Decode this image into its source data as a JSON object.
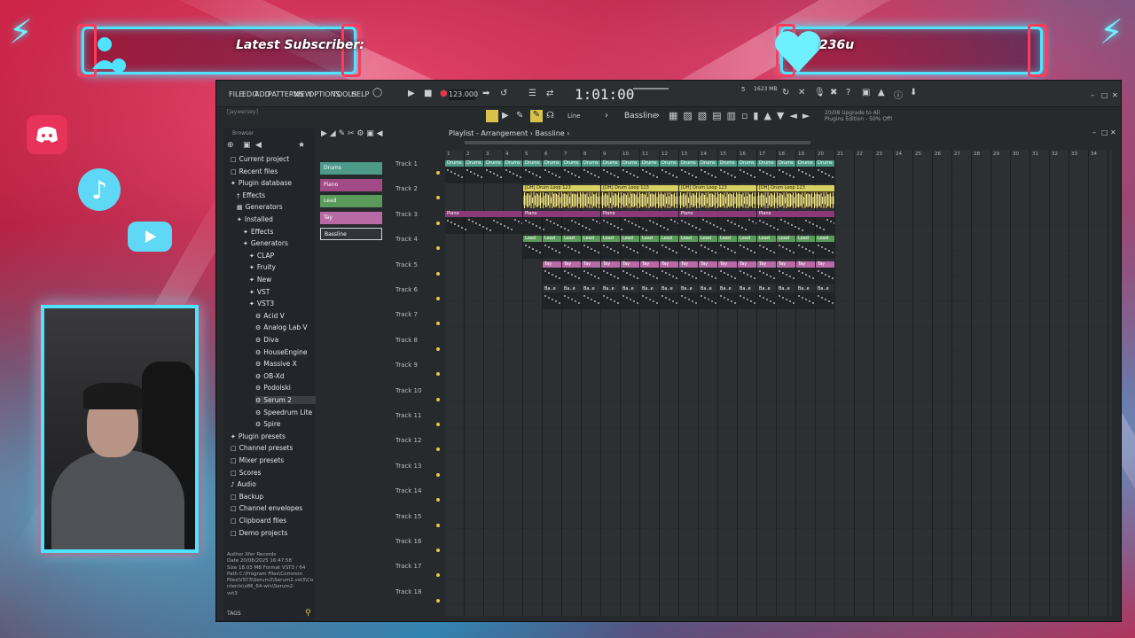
{
  "overlay": {
    "subscriber_label": "Latest Subscriber:",
    "heart_count": "236u",
    "accent": "#4fe3ff",
    "accent2": "#ff3a5a"
  },
  "social_icons": [
    "discord-icon",
    "tiktok-icon",
    "youtube-icon"
  ],
  "menu": [
    "FILE",
    "EDIT",
    "ADD",
    "PATTERNS",
    "VIEW",
    "OPTIONS",
    "TOOLS",
    "HELP"
  ],
  "transport": {
    "bpm": "123.000",
    "time": "1:01:00",
    "mem": "1623 MB",
    "cpu": "5",
    "hint": "[jaywersey]"
  },
  "pattern": {
    "name": "Bassline",
    "snap": "Line",
    "upgrade_line1": "20/08  Upgrade to All",
    "upgrade_line2": "Plugins Edition - 50% Off!"
  },
  "browser": {
    "title": "Browser",
    "items": [
      {
        "label": "Current project",
        "indent": 0,
        "icon": "folder-icon"
      },
      {
        "label": "Recent files",
        "indent": 0,
        "icon": "folder-icon"
      },
      {
        "label": "Plugin database",
        "indent": 0,
        "icon": "plug-icon"
      },
      {
        "label": "Effects",
        "indent": 1,
        "icon": "effects-icon"
      },
      {
        "label": "Generators",
        "indent": 1,
        "icon": "generators-icon"
      },
      {
        "label": "Installed",
        "indent": 1,
        "icon": "plug-icon"
      },
      {
        "label": "Effects",
        "indent": 2,
        "icon": "plug-icon"
      },
      {
        "label": "Generators",
        "indent": 2,
        "icon": "plug-icon"
      },
      {
        "label": "CLAP",
        "indent": 3,
        "icon": "plug-icon"
      },
      {
        "label": "Fruity",
        "indent": 3,
        "icon": "plug-icon"
      },
      {
        "label": "New",
        "indent": 3,
        "icon": "plug-icon"
      },
      {
        "label": "VST",
        "indent": 3,
        "icon": "plug-icon"
      },
      {
        "label": "VST3",
        "indent": 3,
        "icon": "plug-icon"
      },
      {
        "label": "Acid V",
        "indent": 4,
        "icon": "gear-icon"
      },
      {
        "label": "Analog Lab V",
        "indent": 4,
        "icon": "gear-icon"
      },
      {
        "label": "Diva",
        "indent": 4,
        "icon": "gear-icon"
      },
      {
        "label": "HouseEngine",
        "indent": 4,
        "icon": "gear-icon"
      },
      {
        "label": "Massive X",
        "indent": 4,
        "icon": "gear-icon"
      },
      {
        "label": "OB-Xd",
        "indent": 4,
        "icon": "gear-icon"
      },
      {
        "label": "Podolski",
        "indent": 4,
        "icon": "gear-icon"
      },
      {
        "label": "Serum 2",
        "indent": 4,
        "icon": "gear-icon",
        "selected": true
      },
      {
        "label": "Speedrum Lite",
        "indent": 4,
        "icon": "gear-icon"
      },
      {
        "label": "Spire",
        "indent": 4,
        "icon": "gear-icon"
      },
      {
        "label": "Plugin presets",
        "indent": 0,
        "icon": "plug-icon"
      },
      {
        "label": "Channel presets",
        "indent": 0,
        "icon": "folder-icon"
      },
      {
        "label": "Mixer presets",
        "indent": 0,
        "icon": "folder-icon"
      },
      {
        "label": "Scores",
        "indent": 0,
        "icon": "folder-icon"
      },
      {
        "label": "Audio",
        "indent": 0,
        "icon": "audio-icon"
      },
      {
        "label": "Backup",
        "indent": 0,
        "icon": "folder-icon"
      },
      {
        "label": "Channel envelopes",
        "indent": 0,
        "icon": "folder-icon"
      },
      {
        "label": "Clipboard files",
        "indent": 0,
        "icon": "folder-icon"
      },
      {
        "label": "Demo projects",
        "indent": 0,
        "icon": "folder-icon"
      }
    ],
    "info": {
      "author": "Author  Xfer Records",
      "date": "Date    20/08/2025 16:47:58",
      "size": "Size    18.03 MB   Format VST3 / 64",
      "path1": "Path    C:\\Program Files\\Common",
      "path2": "Files\\VST3\\Serum2\\Serum2.vst3\\Co",
      "path3": "ntents\\x86_64-win\\Serum2-",
      "path4": "vst3"
    },
    "tags": "TAGS"
  },
  "picker": [
    {
      "label": "Drums",
      "color": "#4e9a8a"
    },
    {
      "label": "Piano",
      "color": "#a24a86"
    },
    {
      "label": "Lead",
      "color": "#5a9a5a"
    },
    {
      "label": "Tay",
      "color": "#b86aa6"
    },
    {
      "label": "Bassline",
      "color": "#303438"
    }
  ],
  "playlist": {
    "title": "Playlist - Arrangement",
    "pattern": "Bassline",
    "tracks": [
      "Track 1",
      "Track 2",
      "Track 3",
      "Track 4",
      "Track 5",
      "Track 6",
      "Track 7",
      "Track 8",
      "Track 9",
      "Track 10",
      "Track 11",
      "Track 12",
      "Track 13",
      "Track 14",
      "Track 15",
      "Track 16",
      "Track 17",
      "Track 18"
    ],
    "ruler": [
      "1",
      "2",
      "3",
      "4",
      "5",
      "6",
      "7",
      "8",
      "9",
      "10",
      "11",
      "12",
      "13",
      "14",
      "15",
      "16",
      "17",
      "18",
      "19",
      "20",
      "21",
      "22",
      "23",
      "24",
      "25",
      "26",
      "27",
      "28",
      "29",
      "30",
      "31",
      "32",
      "33",
      "34"
    ],
    "clips": {
      "drums": "Drums",
      "drum_loop": "[DH] Drum Loop 123",
      "piano": "Piano",
      "lead": "Lead",
      "tay": "Tay",
      "bassline": "Ba..e"
    },
    "colors": {
      "drums": "#4e9a8a",
      "drum_loop": "#d8d060",
      "piano": "#8a3a78",
      "lead": "#5a9a5a",
      "tay": "#b86aa6",
      "bassline": "#2a2e30"
    }
  }
}
